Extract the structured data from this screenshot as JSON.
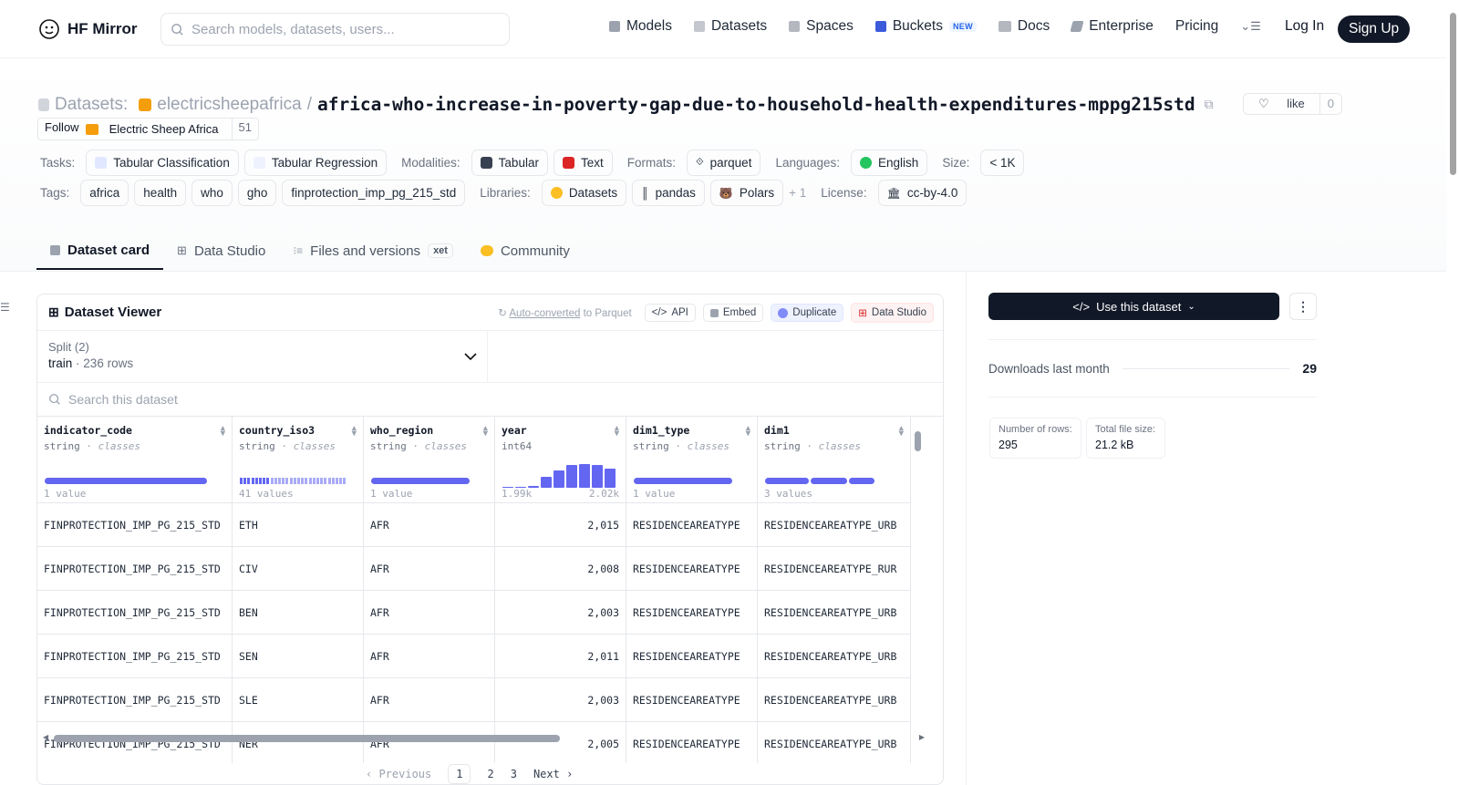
{
  "header": {
    "brand": "HF Mirror",
    "search_placeholder": "Search models, datasets, users...",
    "nav": [
      {
        "label": "Models",
        "icon": "models-icon",
        "color": "#9ca3af"
      },
      {
        "label": "Datasets",
        "icon": "datasets-icon",
        "color": "#9ca3af"
      },
      {
        "label": "Spaces",
        "icon": "spaces-icon",
        "color": "#9ca3af"
      },
      {
        "label": "Buckets",
        "icon": "buckets-icon",
        "color": "#3b5bdb",
        "badge": "NEW"
      },
      {
        "label": "Docs",
        "icon": "docs-icon",
        "color": "#9ca3af"
      },
      {
        "label": "Enterprise",
        "icon": "enterprise-icon",
        "color": "#9ca3af"
      },
      {
        "label": "Pricing"
      }
    ],
    "login": "Log In",
    "signup": "Sign Up"
  },
  "dataset": {
    "section_label": "Datasets:",
    "org": "electricsheepafrica",
    "separator": "/",
    "name": "africa-who-increase-in-poverty-gap-due-to-household-health-expenditures-mppg215std",
    "like_label": "like",
    "like_count": "0",
    "follow_label": "Follow",
    "follow_org": "Electric Sheep Africa",
    "follow_count": "51"
  },
  "meta": {
    "tasks_label": "Tasks:",
    "tasks": [
      "Tabular Classification",
      "Tabular Regression"
    ],
    "modalities_label": "Modalities:",
    "modalities": [
      "Tabular",
      "Text"
    ],
    "formats_label": "Formats:",
    "formats": [
      "parquet"
    ],
    "languages_label": "Languages:",
    "languages": [
      "English"
    ],
    "size_label": "Size:",
    "size": "< 1K",
    "tags_label": "Tags:",
    "tags": [
      "africa",
      "health",
      "who",
      "gho",
      "finprotection_imp_pg_215_std"
    ],
    "libraries_label": "Libraries:",
    "libraries": [
      "Datasets",
      "pandas",
      "Polars"
    ],
    "libraries_more": "+ 1",
    "license_label": "License:",
    "license": "cc-by-4.0"
  },
  "tabs": [
    {
      "label": "Dataset card",
      "active": true
    },
    {
      "label": "Data Studio"
    },
    {
      "label": "Files and versions",
      "badge": "xet"
    },
    {
      "label": "Community"
    }
  ],
  "viewer": {
    "title": "Dataset Viewer",
    "auto_converted": "Auto-converted",
    "to_parquet": "to Parquet",
    "buttons": [
      "API",
      "Embed",
      "Duplicate",
      "Data Studio"
    ],
    "split_label": "Split (2)",
    "split_value": "train",
    "split_dot": "·",
    "split_rows": "236 rows",
    "search_placeholder": "Search this dataset",
    "columns": [
      {
        "name": "indicator_code",
        "type": "string",
        "kind": "classes",
        "summary": "1 value"
      },
      {
        "name": "country_iso3",
        "type": "string",
        "kind": "classes",
        "summary": "41 values"
      },
      {
        "name": "who_region",
        "type": "string",
        "kind": "classes",
        "summary": "1 value"
      },
      {
        "name": "year",
        "type": "int64",
        "kind": "",
        "summary": "1.99k",
        "summary_max": "2.02k"
      },
      {
        "name": "dim1_type",
        "type": "string",
        "kind": "classes",
        "summary": "1 value"
      },
      {
        "name": "dim1",
        "type": "string",
        "kind": "classes",
        "summary": "3 values"
      }
    ],
    "type_sep": "·",
    "year_histogram": [
      0.05,
      0.0,
      0.08,
      0.45,
      0.75,
      0.95,
      1.0,
      0.95,
      0.8
    ],
    "rows": [
      [
        "FINPROTECTION_IMP_PG_215_STD",
        "ETH",
        "AFR",
        "2,015",
        "RESIDENCEAREATYPE",
        "RESIDENCEAREATYPE_URB"
      ],
      [
        "FINPROTECTION_IMP_PG_215_STD",
        "CIV",
        "AFR",
        "2,008",
        "RESIDENCEAREATYPE",
        "RESIDENCEAREATYPE_RUR"
      ],
      [
        "FINPROTECTION_IMP_PG_215_STD",
        "BEN",
        "AFR",
        "2,003",
        "RESIDENCEAREATYPE",
        "RESIDENCEAREATYPE_URB"
      ],
      [
        "FINPROTECTION_IMP_PG_215_STD",
        "SEN",
        "AFR",
        "2,011",
        "RESIDENCEAREATYPE",
        "RESIDENCEAREATYPE_URB"
      ],
      [
        "FINPROTECTION_IMP_PG_215_STD",
        "SLE",
        "AFR",
        "2,003",
        "RESIDENCEAREATYPE",
        "RESIDENCEAREATYPE_URB"
      ],
      [
        "FINPROTECTION_IMP_PG_215_STD",
        "NER",
        "AFR",
        "2,005",
        "RESIDENCEAREATYPE",
        "RESIDENCEAREATYPE_URB"
      ]
    ],
    "pager": {
      "prev": "Previous",
      "pages": [
        "1",
        "2",
        "3"
      ],
      "next": "Next"
    }
  },
  "sidebar": {
    "use_button": "Use this dataset",
    "downloads_label": "Downloads last month",
    "downloads": "29",
    "rows_label": "Number of rows:",
    "rows_value": "295",
    "size_label": "Total file size:",
    "size_value": "21.2 kB"
  },
  "colors": {
    "accent": "#6366f1",
    "dark": "#111827"
  }
}
